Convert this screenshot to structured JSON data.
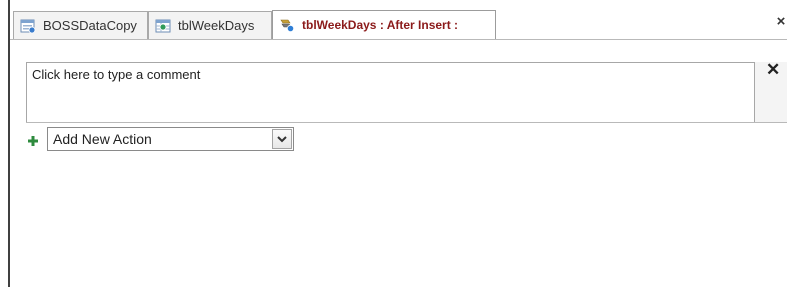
{
  "tabs": [
    {
      "label": "BOSSDataCopy",
      "icon": "form-icon",
      "active": false
    },
    {
      "label": "tblWeekDays",
      "icon": "table-icon",
      "active": false
    },
    {
      "label": "tblWeekDays : After Insert :",
      "icon": "macro-icon",
      "active": true
    }
  ],
  "window": {
    "close_label": "×"
  },
  "comment": {
    "text": "Click here to type a comment",
    "remove_label": "✕"
  },
  "action": {
    "add_icon": "plus-icon",
    "selected": "Add New Action"
  },
  "colors": {
    "active_tab_text": "#8b1a1a",
    "plus_green": "#2e8b3e"
  }
}
